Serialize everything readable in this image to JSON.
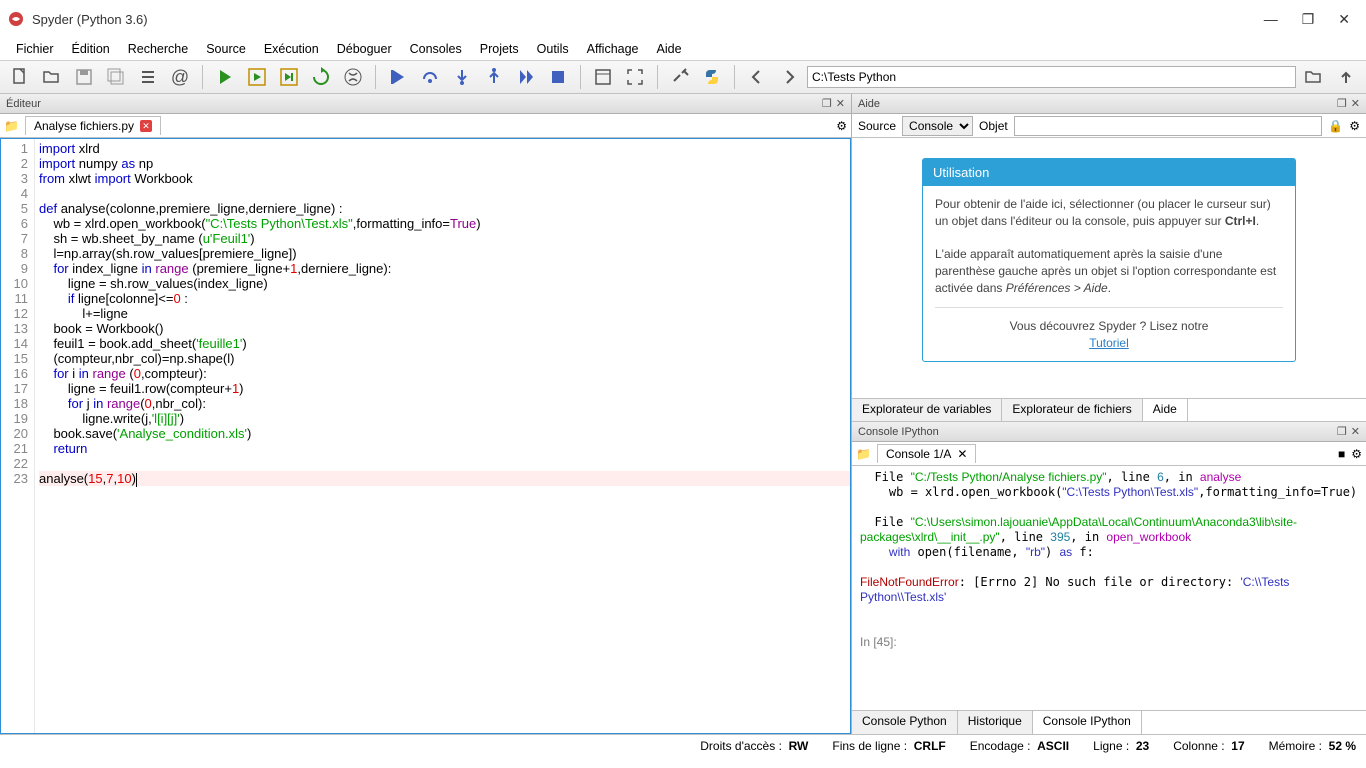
{
  "title": "Spyder (Python 3.6)",
  "menu": [
    "Fichier",
    "Édition",
    "Recherche",
    "Source",
    "Exécution",
    "Déboguer",
    "Consoles",
    "Projets",
    "Outils",
    "Affichage",
    "Aide"
  ],
  "path": "C:\\Tests Python",
  "editor": {
    "pane_title": "Éditeur",
    "tab": "Analyse fichiers.py",
    "lines": [
      1,
      2,
      3,
      4,
      5,
      6,
      7,
      8,
      9,
      10,
      11,
      12,
      13,
      14,
      15,
      16,
      17,
      18,
      19,
      20,
      21,
      22,
      23
    ]
  },
  "help": {
    "pane_title": "Aide",
    "source_label": "Source",
    "source_value": "Console",
    "object_label": "Objet",
    "box_title": "Utilisation",
    "p1": "Pour obtenir de l'aide ici, sélectionner (ou placer le curseur sur) un objet dans l'éditeur ou la console, puis appuyer sur ",
    "p1b": "Ctrl+I",
    "p2a": "L'aide apparaît automatiquement après la saisie d'une parenthèse gauche après un objet si l'option correspondante est activée dans ",
    "p2b": "Préférences > Aide",
    "p3": "Vous découvrez Spyder ? Lisez notre",
    "p3link": "Tutoriel",
    "tabs": [
      "Explorateur de variables",
      "Explorateur de fichiers",
      "Aide"
    ]
  },
  "console": {
    "pane_title": "Console IPython",
    "tab": "Console 1/A",
    "bottom_tabs": [
      "Console Python",
      "Historique",
      "Console IPython"
    ],
    "prompt": "In [45]:"
  },
  "status": {
    "perm_label": "Droits d'accès :",
    "perm_value": "RW",
    "eol_label": "Fins de ligne :",
    "eol_value": "CRLF",
    "enc_label": "Encodage :",
    "enc_value": "ASCII",
    "line_label": "Ligne :",
    "line_value": "23",
    "col_label": "Colonne :",
    "col_value": "17",
    "mem_label": "Mémoire :",
    "mem_value": "52 %"
  }
}
